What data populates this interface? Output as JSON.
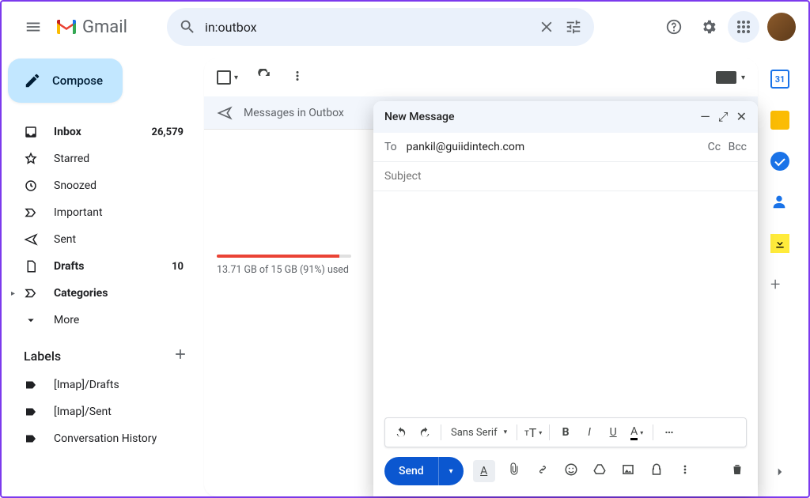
{
  "header": {
    "app_name": "Gmail",
    "search_value": "in:outbox"
  },
  "compose_btn": "Compose",
  "folders": [
    {
      "icon": "inbox",
      "label": "Inbox",
      "count": "26,579",
      "bold": true
    },
    {
      "icon": "star",
      "label": "Starred",
      "count": "",
      "bold": false
    },
    {
      "icon": "clock",
      "label": "Snoozed",
      "count": "",
      "bold": false
    },
    {
      "icon": "important",
      "label": "Important",
      "count": "",
      "bold": false
    },
    {
      "icon": "send",
      "label": "Sent",
      "count": "",
      "bold": false
    },
    {
      "icon": "file",
      "label": "Drafts",
      "count": "10",
      "bold": true
    },
    {
      "icon": "categories",
      "label": "Categories",
      "count": "",
      "bold": true,
      "caret": true
    },
    {
      "icon": "more",
      "label": "More",
      "count": "",
      "bold": false
    }
  ],
  "labels_header": "Labels",
  "labels": [
    {
      "label": "[Imap]/Drafts"
    },
    {
      "label": "[Imap]/Sent"
    },
    {
      "label": "Conversation History"
    }
  ],
  "outbox_banner": "Messages in Outbox",
  "storage": {
    "text": "13.71 GB of 15 GB (91%) used",
    "percent": 91
  },
  "sidepanel": {
    "calendar_day": "31"
  },
  "compose": {
    "title": "New Message",
    "to_label": "To",
    "to_value": "pankil@guiidintech.com",
    "cc": "Cc",
    "bcc": "Bcc",
    "subject_placeholder": "Subject",
    "font_name": "Sans Serif",
    "send_label": "Send"
  }
}
